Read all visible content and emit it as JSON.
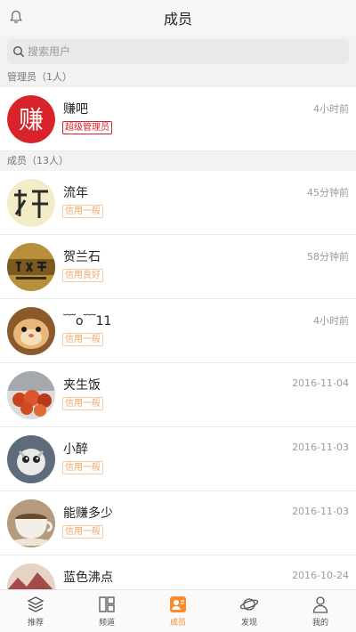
{
  "header": {
    "title": "成员"
  },
  "search": {
    "placeholder": "搜索用户"
  },
  "admins": {
    "heading": "管理员（1人）",
    "items": [
      {
        "name": "赚吧",
        "time": "4小时前",
        "badge": "超级管理员",
        "avatar_text": "赚"
      }
    ]
  },
  "members": {
    "heading": "成员（13人）",
    "items": [
      {
        "name": "流年",
        "time": "45分钟前",
        "badge": "信用一般"
      },
      {
        "name": "贺兰石",
        "time": "58分钟前",
        "badge": "信用良好"
      },
      {
        "name": "﹋o﹋11",
        "time": "4小时前",
        "badge": "信用一般"
      },
      {
        "name": "夹生饭",
        "time": "2016-11-04",
        "badge": "信用一般"
      },
      {
        "name": "小醉",
        "time": "2016-11-03",
        "badge": "信用一般"
      },
      {
        "name": "能赚多少",
        "time": "2016-11-03",
        "badge": "信用一般"
      },
      {
        "name": "蓝色沸点",
        "time": "2016-10-24",
        "badge": ""
      }
    ]
  },
  "tabbar": {
    "items": [
      {
        "label": "推荐",
        "icon": "layers-icon"
      },
      {
        "label": "频道",
        "icon": "grid-icon"
      },
      {
        "label": "成员",
        "icon": "member-icon"
      },
      {
        "label": "发现",
        "icon": "planet-icon"
      },
      {
        "label": "我的",
        "icon": "person-icon"
      }
    ]
  },
  "colors": {
    "accent": "#ff8a2b",
    "admin_red": "#d8232a",
    "credit": "#f0a86a"
  }
}
